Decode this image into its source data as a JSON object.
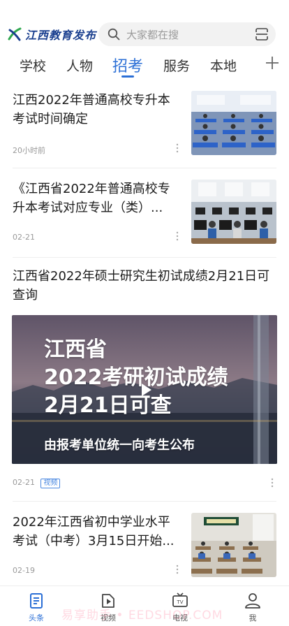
{
  "header": {
    "logo_text": "江西教育发布",
    "search_placeholder": "大家都在搜"
  },
  "tabs": [
    {
      "label": "学校",
      "active": false
    },
    {
      "label": "人物",
      "active": false
    },
    {
      "label": "招考",
      "active": true
    },
    {
      "label": "服务",
      "active": false
    },
    {
      "label": "本地",
      "active": false
    }
  ],
  "feed": [
    {
      "title": "江西2022年普通高校专升本考试时间确定",
      "time": "20小时前",
      "thumb_icon": "classroom-exam-photo"
    },
    {
      "title": "《江西省2022年普通高校专升本考试对应专业（类）...",
      "time": "02-21",
      "thumb_icon": "computer-lab-photo"
    },
    {
      "title": "江西省2022年硕士研究生初试成绩2月21日可查询",
      "time": "02-21",
      "tag": "视频",
      "video_caption": {
        "line1": "江西省",
        "line2": "2022考研初试成绩",
        "line3": "2月21日可查",
        "line4": "由报考单位统一向考生公布"
      }
    },
    {
      "title": "2022年江西省初中学业水平考试（中考）3月15日开始...",
      "time": "02-19",
      "thumb_icon": "middle-school-exam-photo"
    }
  ],
  "bottom_nav": [
    {
      "label": "头条",
      "icon": "headline-icon",
      "active": true
    },
    {
      "label": "视频",
      "icon": "video-icon",
      "active": false
    },
    {
      "label": "电视",
      "icon": "tv-icon",
      "active": false
    },
    {
      "label": "我",
      "icon": "profile-icon",
      "active": false
    }
  ],
  "overlay": {
    "watermark": "易享助手 • EEDSHOP.COM"
  },
  "colors": {
    "accent": "#2b6fd6",
    "logo": "#1a3f8f"
  }
}
